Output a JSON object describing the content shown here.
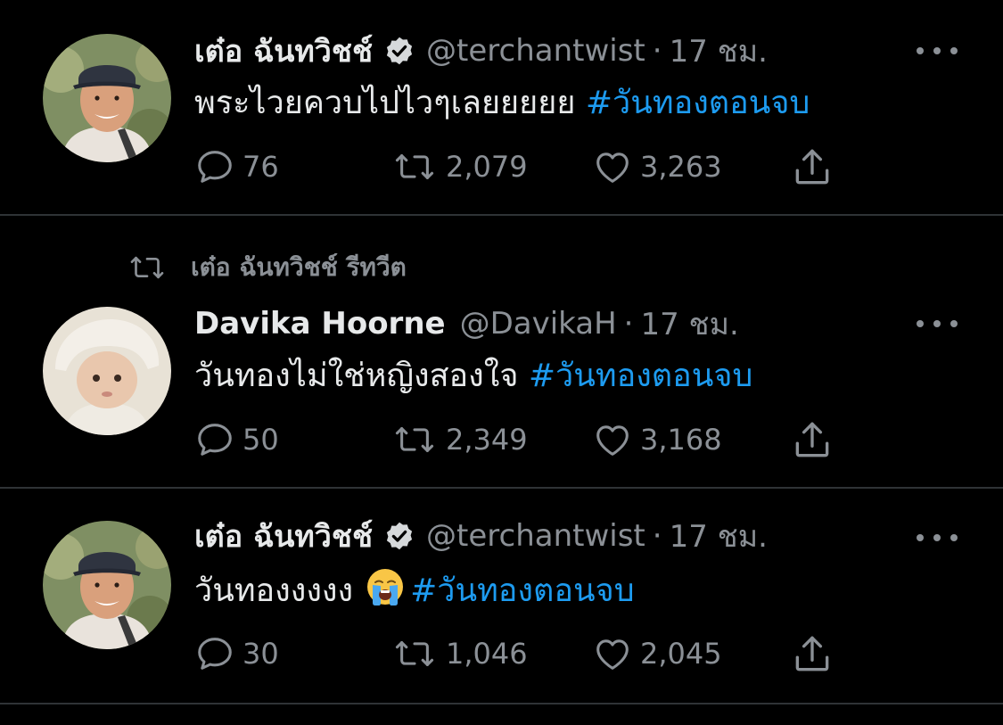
{
  "tweets": [
    {
      "name": "เต๋อ ฉันทวิชช์",
      "handle": "@terchantwist",
      "separator": "·",
      "time": "17 ชม.",
      "verified": true,
      "text": "พระไวยควบไปไวๆเลยยยยย ",
      "hashtag": "#วันทองตอนจบ",
      "reply_count": "76",
      "retweet_count": "2,079",
      "like_count": "3,263"
    },
    {
      "retweeted_by": "เต๋อ ฉันทวิชช์ รีทวีต",
      "name": "Davika Hoorne",
      "handle": "@DavikaH",
      "separator": "·",
      "time": "17 ชม.",
      "verified": false,
      "text": "วันทองไม่ใช่หญิงสองใจ ",
      "hashtag": "#วันทองตอนจบ",
      "reply_count": "50",
      "retweet_count": "2,349",
      "like_count": "3,168"
    },
    {
      "name": "เต๋อ ฉันทวิชช์",
      "handle": "@terchantwist",
      "separator": "·",
      "time": "17 ชม.",
      "verified": true,
      "text": "วันทองงงงง",
      "emoji": "loudly-crying-face",
      "hashtag": "#วันทองตอนจบ",
      "reply_count": "30",
      "retweet_count": "1,046",
      "like_count": "2,045"
    }
  ],
  "colors": {
    "background": "#000000",
    "primary_text": "#e7e9ea",
    "secondary_text": "#8b9096",
    "link": "#1d9bf0",
    "divider": "#2f3336"
  },
  "icons": [
    "reply-icon",
    "retweet-icon",
    "like-icon",
    "share-icon",
    "verified-badge-icon",
    "more-icon"
  ]
}
